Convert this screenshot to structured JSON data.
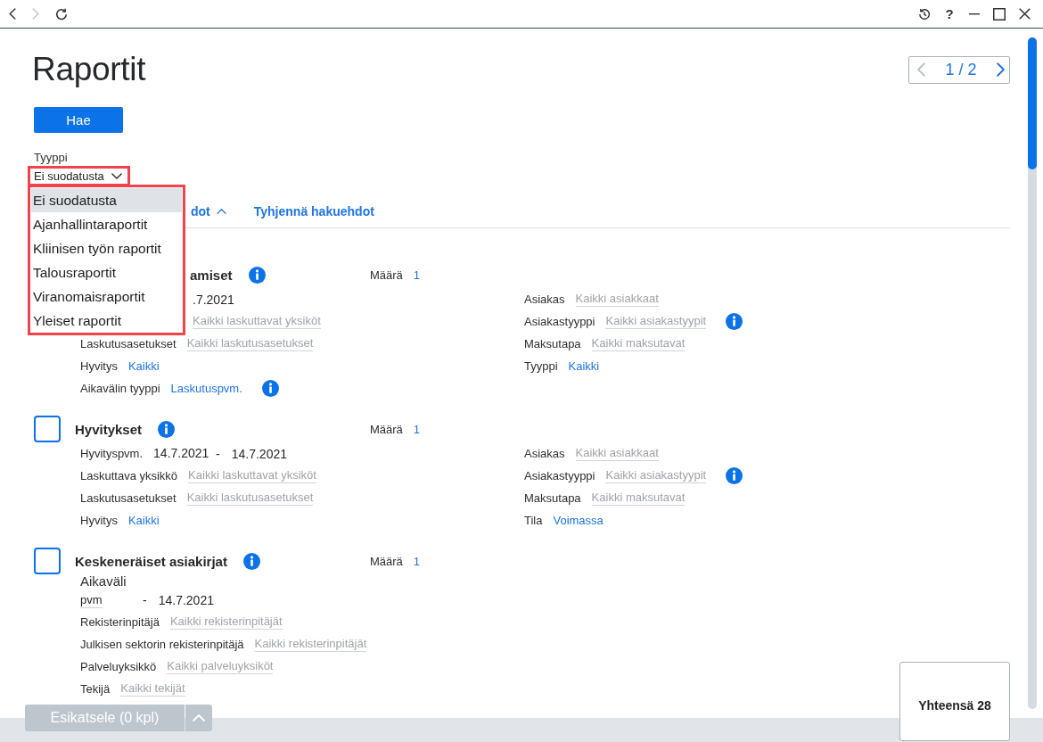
{
  "titlebar": {
    "nav_buttons": [
      {
        "kind": "back",
        "disabled": false
      },
      {
        "kind": "forward",
        "disabled": true
      },
      {
        "kind": "reload",
        "disabled": false
      }
    ],
    "controls": [
      {
        "kind": "history"
      },
      {
        "kind": "help",
        "text": "?"
      },
      {
        "kind": "minimize"
      },
      {
        "kind": "maximize"
      },
      {
        "kind": "close"
      }
    ]
  },
  "page": {
    "title": "Raportit",
    "pager": {
      "text": "1 / 2",
      "prev": {
        "disabled": true
      },
      "next": {
        "disabled": false
      }
    }
  },
  "search_button": "Hae",
  "type_filter": {
    "label": "Tyyppi",
    "value": "Ei suodatusta",
    "expanded": true,
    "highlighted": true,
    "options": [
      {
        "label": "Ei suodatusta",
        "selected": true
      },
      {
        "label": "Ajanhallintaraportit",
        "selected": false
      },
      {
        "label": "Kliinisen työn raportit",
        "selected": false
      },
      {
        "label": "Talousraportit",
        "selected": false
      },
      {
        "label": "Viranomaisraportit",
        "selected": false
      },
      {
        "label": "Yleiset raportit",
        "selected": false
      }
    ]
  },
  "search_links": [
    {
      "text": "dot",
      "expanded": true
    },
    {
      "text": "Tyhjennä hakuehdot"
    }
  ],
  "reports": [
    {
      "title": "amiset",
      "info": true,
      "count_label": "Määrä",
      "count": "1",
      "left": [
        {
          "kind": "date_range",
          "to": {
            "value": ".7.2021"
          }
        },
        {
          "kind": "select",
          "placeholder": "Kaikki laskuttavat yksiköt"
        },
        {
          "kind": "select",
          "label": "Laskutusasetukset",
          "placeholder": "Kaikki laskutusasetukset"
        },
        {
          "kind": "link",
          "label": "Hyvitys",
          "value": "Kaikki"
        },
        {
          "kind": "link",
          "label": "Aikavälin tyyppi",
          "value": "Laskutuspvm.",
          "info": true
        }
      ],
      "right": [
        {
          "kind": "select",
          "label": "Asiakas",
          "placeholder": "Kaikki asiakkaat"
        },
        {
          "kind": "select",
          "label": "Asiakastyyppi",
          "placeholder": "Kaikki asiakastyypit",
          "info": true
        },
        {
          "kind": "select",
          "label": "Maksutapa",
          "placeholder": "Kaikki maksutavat"
        },
        {
          "kind": "link",
          "label": "Tyyppi",
          "value": "Kaikki"
        }
      ]
    },
    {
      "title": "Hyvitykset",
      "checked": false,
      "info": true,
      "count_label": "Määrä",
      "count": "1",
      "left": [
        {
          "kind": "date_range",
          "label": "Hyvityspvm.",
          "from": {
            "value": "14.7.2021"
          },
          "separator": "-",
          "to": {
            "value": "14.7.2021"
          }
        },
        {
          "kind": "select",
          "label": "Laskuttava yksikkö",
          "placeholder": "Kaikki laskuttavat yksiköt"
        },
        {
          "kind": "select",
          "label": "Laskutusasetukset",
          "placeholder": "Kaikki laskutusasetukset"
        },
        {
          "kind": "link",
          "label": "Hyvitys",
          "value": "Kaikki"
        }
      ],
      "right": [
        {
          "kind": "select",
          "label": "Asiakas",
          "placeholder": "Kaikki asiakkaat"
        },
        {
          "kind": "select",
          "label": "Asiakastyyppi",
          "placeholder": "Kaikki asiakastyypit",
          "info": true
        },
        {
          "kind": "select",
          "label": "Maksutapa",
          "placeholder": "Kaikki maksutavat"
        },
        {
          "kind": "link",
          "label": "Tila",
          "value": "Voimassa"
        }
      ]
    },
    {
      "title": "Keskeneräiset asiakirjat",
      "checked": false,
      "info": true,
      "count_label": "Määrä",
      "count": "1",
      "left": [
        {
          "kind": "period",
          "label": "Aikaväli",
          "from": {
            "placeholder": "pvm"
          },
          "separator": "-",
          "to": {
            "value": "14.7.2021"
          }
        },
        {
          "kind": "select",
          "label": "Rekisterinpitäjä",
          "placeholder": "Kaikki rekisterinpitäjät"
        },
        {
          "kind": "select",
          "label": "Julkisen sektorin rekisterinpitäjä",
          "placeholder": "Kaikki rekisterinpitäjät"
        },
        {
          "kind": "select",
          "label": "Palveluyksikkö",
          "placeholder": "Kaikki palveluyksiköt"
        },
        {
          "kind": "select",
          "label": "Tekijä",
          "placeholder": "Kaikki tekijät"
        }
      ]
    }
  ],
  "footer": {
    "preview_button": {
      "text": "Esikatsele (0 kpl)",
      "disabled": true
    },
    "expand_button": {
      "disabled": true
    },
    "total": "Yhteensä 28"
  }
}
